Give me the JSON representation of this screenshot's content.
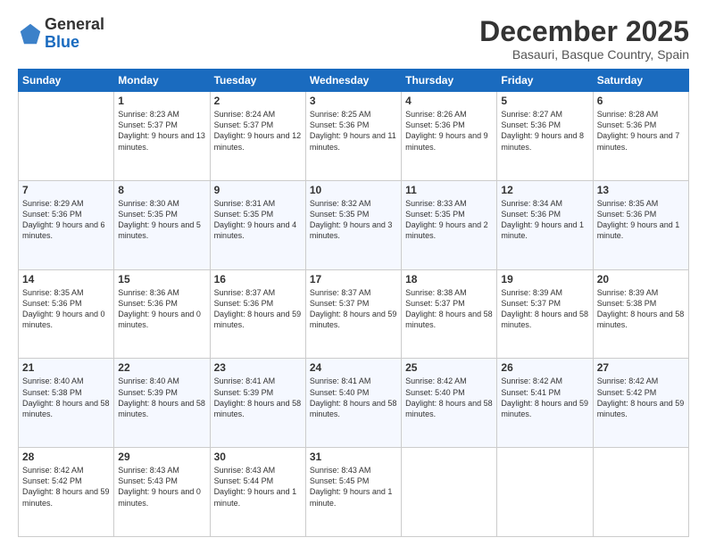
{
  "header": {
    "logo_line1": "General",
    "logo_line2": "Blue",
    "month": "December 2025",
    "location": "Basauri, Basque Country, Spain"
  },
  "days_of_week": [
    "Sunday",
    "Monday",
    "Tuesday",
    "Wednesday",
    "Thursday",
    "Friday",
    "Saturday"
  ],
  "weeks": [
    [
      {
        "num": "",
        "sunrise": "",
        "sunset": "",
        "daylight": ""
      },
      {
        "num": "1",
        "sunrise": "Sunrise: 8:23 AM",
        "sunset": "Sunset: 5:37 PM",
        "daylight": "Daylight: 9 hours and 13 minutes."
      },
      {
        "num": "2",
        "sunrise": "Sunrise: 8:24 AM",
        "sunset": "Sunset: 5:37 PM",
        "daylight": "Daylight: 9 hours and 12 minutes."
      },
      {
        "num": "3",
        "sunrise": "Sunrise: 8:25 AM",
        "sunset": "Sunset: 5:36 PM",
        "daylight": "Daylight: 9 hours and 11 minutes."
      },
      {
        "num": "4",
        "sunrise": "Sunrise: 8:26 AM",
        "sunset": "Sunset: 5:36 PM",
        "daylight": "Daylight: 9 hours and 9 minutes."
      },
      {
        "num": "5",
        "sunrise": "Sunrise: 8:27 AM",
        "sunset": "Sunset: 5:36 PM",
        "daylight": "Daylight: 9 hours and 8 minutes."
      },
      {
        "num": "6",
        "sunrise": "Sunrise: 8:28 AM",
        "sunset": "Sunset: 5:36 PM",
        "daylight": "Daylight: 9 hours and 7 minutes."
      }
    ],
    [
      {
        "num": "7",
        "sunrise": "Sunrise: 8:29 AM",
        "sunset": "Sunset: 5:36 PM",
        "daylight": "Daylight: 9 hours and 6 minutes."
      },
      {
        "num": "8",
        "sunrise": "Sunrise: 8:30 AM",
        "sunset": "Sunset: 5:35 PM",
        "daylight": "Daylight: 9 hours and 5 minutes."
      },
      {
        "num": "9",
        "sunrise": "Sunrise: 8:31 AM",
        "sunset": "Sunset: 5:35 PM",
        "daylight": "Daylight: 9 hours and 4 minutes."
      },
      {
        "num": "10",
        "sunrise": "Sunrise: 8:32 AM",
        "sunset": "Sunset: 5:35 PM",
        "daylight": "Daylight: 9 hours and 3 minutes."
      },
      {
        "num": "11",
        "sunrise": "Sunrise: 8:33 AM",
        "sunset": "Sunset: 5:35 PM",
        "daylight": "Daylight: 9 hours and 2 minutes."
      },
      {
        "num": "12",
        "sunrise": "Sunrise: 8:34 AM",
        "sunset": "Sunset: 5:36 PM",
        "daylight": "Daylight: 9 hours and 1 minute."
      },
      {
        "num": "13",
        "sunrise": "Sunrise: 8:35 AM",
        "sunset": "Sunset: 5:36 PM",
        "daylight": "Daylight: 9 hours and 1 minute."
      }
    ],
    [
      {
        "num": "14",
        "sunrise": "Sunrise: 8:35 AM",
        "sunset": "Sunset: 5:36 PM",
        "daylight": "Daylight: 9 hours and 0 minutes."
      },
      {
        "num": "15",
        "sunrise": "Sunrise: 8:36 AM",
        "sunset": "Sunset: 5:36 PM",
        "daylight": "Daylight: 9 hours and 0 minutes."
      },
      {
        "num": "16",
        "sunrise": "Sunrise: 8:37 AM",
        "sunset": "Sunset: 5:36 PM",
        "daylight": "Daylight: 8 hours and 59 minutes."
      },
      {
        "num": "17",
        "sunrise": "Sunrise: 8:37 AM",
        "sunset": "Sunset: 5:37 PM",
        "daylight": "Daylight: 8 hours and 59 minutes."
      },
      {
        "num": "18",
        "sunrise": "Sunrise: 8:38 AM",
        "sunset": "Sunset: 5:37 PM",
        "daylight": "Daylight: 8 hours and 58 minutes."
      },
      {
        "num": "19",
        "sunrise": "Sunrise: 8:39 AM",
        "sunset": "Sunset: 5:37 PM",
        "daylight": "Daylight: 8 hours and 58 minutes."
      },
      {
        "num": "20",
        "sunrise": "Sunrise: 8:39 AM",
        "sunset": "Sunset: 5:38 PM",
        "daylight": "Daylight: 8 hours and 58 minutes."
      }
    ],
    [
      {
        "num": "21",
        "sunrise": "Sunrise: 8:40 AM",
        "sunset": "Sunset: 5:38 PM",
        "daylight": "Daylight: 8 hours and 58 minutes."
      },
      {
        "num": "22",
        "sunrise": "Sunrise: 8:40 AM",
        "sunset": "Sunset: 5:39 PM",
        "daylight": "Daylight: 8 hours and 58 minutes."
      },
      {
        "num": "23",
        "sunrise": "Sunrise: 8:41 AM",
        "sunset": "Sunset: 5:39 PM",
        "daylight": "Daylight: 8 hours and 58 minutes."
      },
      {
        "num": "24",
        "sunrise": "Sunrise: 8:41 AM",
        "sunset": "Sunset: 5:40 PM",
        "daylight": "Daylight: 8 hours and 58 minutes."
      },
      {
        "num": "25",
        "sunrise": "Sunrise: 8:42 AM",
        "sunset": "Sunset: 5:40 PM",
        "daylight": "Daylight: 8 hours and 58 minutes."
      },
      {
        "num": "26",
        "sunrise": "Sunrise: 8:42 AM",
        "sunset": "Sunset: 5:41 PM",
        "daylight": "Daylight: 8 hours and 59 minutes."
      },
      {
        "num": "27",
        "sunrise": "Sunrise: 8:42 AM",
        "sunset": "Sunset: 5:42 PM",
        "daylight": "Daylight: 8 hours and 59 minutes."
      }
    ],
    [
      {
        "num": "28",
        "sunrise": "Sunrise: 8:42 AM",
        "sunset": "Sunset: 5:42 PM",
        "daylight": "Daylight: 8 hours and 59 minutes."
      },
      {
        "num": "29",
        "sunrise": "Sunrise: 8:43 AM",
        "sunset": "Sunset: 5:43 PM",
        "daylight": "Daylight: 9 hours and 0 minutes."
      },
      {
        "num": "30",
        "sunrise": "Sunrise: 8:43 AM",
        "sunset": "Sunset: 5:44 PM",
        "daylight": "Daylight: 9 hours and 1 minute."
      },
      {
        "num": "31",
        "sunrise": "Sunrise: 8:43 AM",
        "sunset": "Sunset: 5:45 PM",
        "daylight": "Daylight: 9 hours and 1 minute."
      },
      {
        "num": "",
        "sunrise": "",
        "sunset": "",
        "daylight": ""
      },
      {
        "num": "",
        "sunrise": "",
        "sunset": "",
        "daylight": ""
      },
      {
        "num": "",
        "sunrise": "",
        "sunset": "",
        "daylight": ""
      }
    ]
  ]
}
